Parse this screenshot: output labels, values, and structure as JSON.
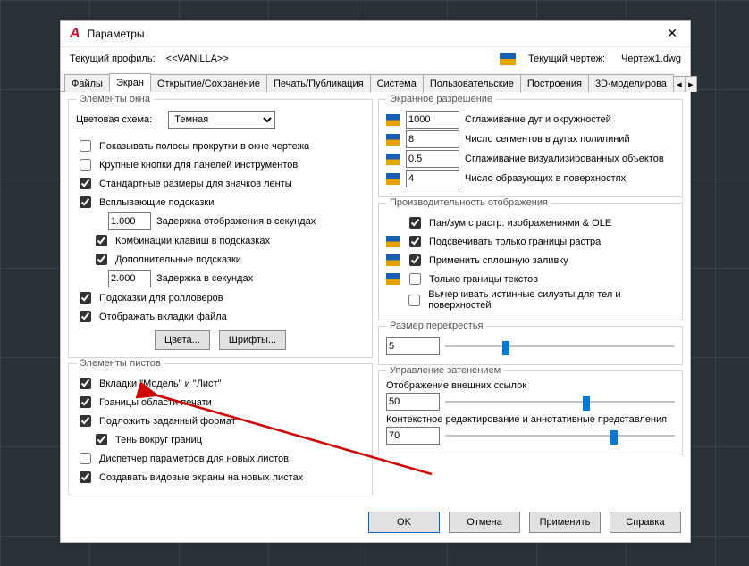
{
  "window": {
    "title": "Параметры"
  },
  "profile": {
    "label": "Текущий профиль:",
    "value": "<<VANILLA>>",
    "drawing_label": "Текущий чертеж:",
    "drawing_value": "Чертеж1.dwg"
  },
  "tabs": {
    "t0": "Файлы",
    "t1": "Экран",
    "t2": "Открытие/Сохранение",
    "t3": "Печать/Публикация",
    "t4": "Система",
    "t5": "Пользовательские",
    "t6": "Построения",
    "t7": "3D-моделирова"
  },
  "left": {
    "group1_title": "Элементы окна",
    "color_scheme_label": "Цветовая схема:",
    "color_scheme_value": "Темная",
    "cb_scroll": "Показывать полосы прокрутки в окне чертежа",
    "cb_bigbtn": "Крупные кнопки для панелей инструментов",
    "cb_std_ribbon": "Стандартные размеры для значков ленты",
    "cb_tooltips": "Всплывающие подсказки",
    "tip_delay_val": "1.000",
    "tip_delay_lbl": "Задержка отображения в секундах",
    "cb_shortcuts": "Комбинации клавиш в подсказках",
    "cb_exttips": "Дополнительные подсказки",
    "ext_delay_val": "2.000",
    "ext_delay_lbl": "Задержка в секундах",
    "cb_rollover": "Подсказки для ролловеров",
    "cb_filetabs": "Отображать вкладки файла",
    "btn_colors": "Цвета...",
    "btn_fonts": "Шрифты...",
    "group2_title": "Элементы листов",
    "cb_modellist": "Вкладки \"Модель\" и \"Лист\"",
    "cb_printarea": "Границы области печати",
    "cb_pageformat": "Подложить заданный формат",
    "cb_shadow": "Тень вокруг границ",
    "cb_mgr": "Диспетчер параметров для новых листов",
    "cb_viewports": "Создавать видовые экраны на новых листах"
  },
  "right": {
    "group1_title": "Экранное разрешение",
    "r1_val": "1000",
    "r1_lbl": "Сглаживание дуг и окружностей",
    "r2_val": "8",
    "r2_lbl": "Число сегментов в дугах полилиний",
    "r3_val": "0.5",
    "r3_lbl": "Сглаживание визуализированных объектов",
    "r4_val": "4",
    "r4_lbl": "Число образующих в поверхностях",
    "group2_title": "Производительность отображения",
    "p1": "Пан/зум с растр. изображениями & OLE",
    "p2": "Подсвечивать только границы растра",
    "p3": "Применить сплошную заливку",
    "p4": "Только границы текстов",
    "p5": "Вычерчивать истинные силуэты для тел и поверхностей",
    "group3_title": "Размер перекрестья",
    "cross_val": "5",
    "group4_title": "Управление затенением",
    "xref_lbl": "Отображение внешних ссылок",
    "xref_val": "50",
    "ctx_lbl": "Контекстное редактирование и аннотативные представления",
    "ctx_val": "70"
  },
  "footer": {
    "ok": "OK",
    "cancel": "Отмена",
    "apply": "Применить",
    "help": "Справка"
  }
}
